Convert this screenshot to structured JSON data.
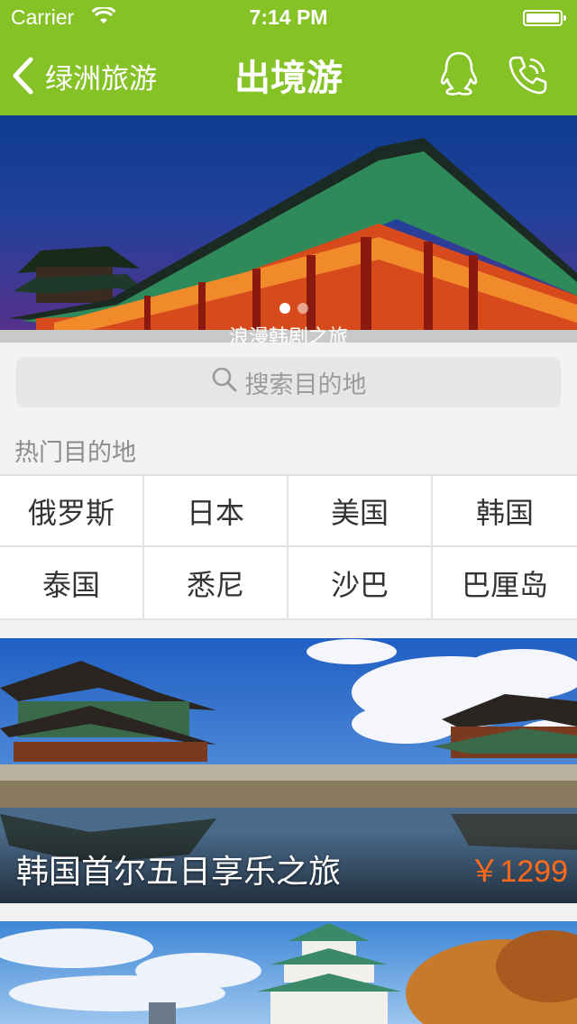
{
  "status_bar": {
    "carrier": "Carrier",
    "time": "7:14 PM"
  },
  "nav": {
    "back_label": "绿洲旅游",
    "title": "出境游",
    "qq_icon": "qq-icon",
    "phone_icon": "phone-icon"
  },
  "banner": {
    "caption": "浪漫韩剧之旅",
    "slide_count": 2,
    "active_slide": 1
  },
  "search": {
    "placeholder": "搜索目的地"
  },
  "hot": {
    "title": "热门目的地",
    "destinations": [
      "俄罗斯",
      "日本",
      "美国",
      "韩国",
      "泰国",
      "悉尼",
      "沙巴",
      "巴厘岛"
    ]
  },
  "tours": [
    {
      "title": "韩国首尔五日享乐之旅",
      "price": "￥1299"
    }
  ],
  "colors": {
    "brand": "#84c226",
    "price": "#ff6a1a"
  }
}
